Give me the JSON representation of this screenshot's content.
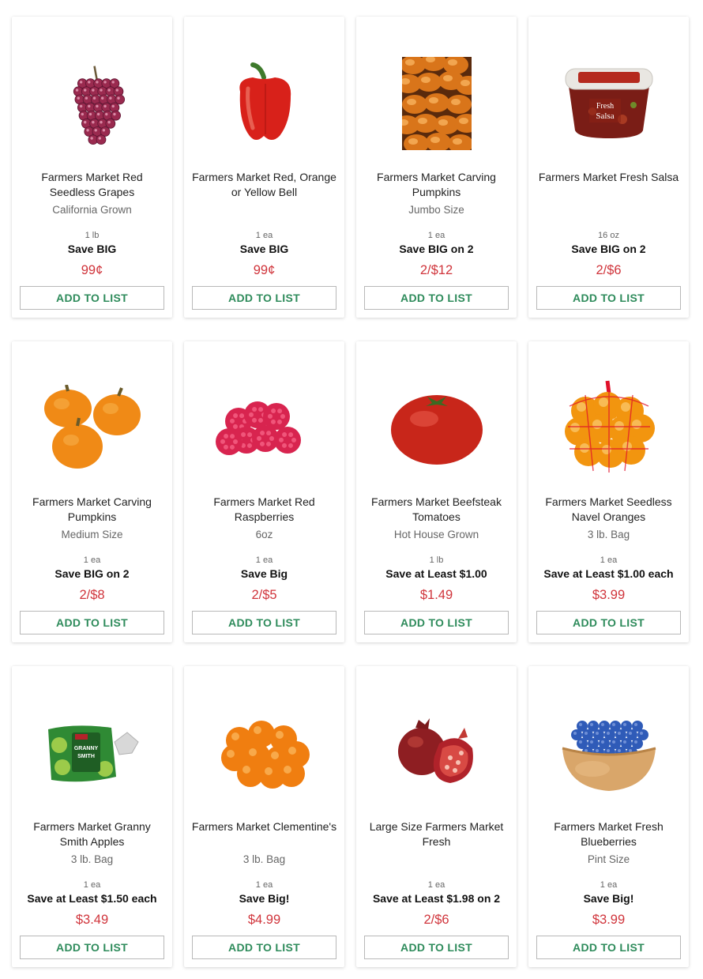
{
  "products": [
    {
      "name": "Farmers Market Red Seedless Grapes",
      "size": "California Grown",
      "unit": "1 lb",
      "deal": "Save BIG",
      "price": "99¢",
      "button": "ADD TO LIST",
      "image": "grapes"
    },
    {
      "name": "Farmers Market Red, Orange or Yellow Bell",
      "size": "",
      "unit": "1 ea",
      "deal": "Save BIG",
      "price": "99¢",
      "button": "ADD TO LIST",
      "image": "bell-pepper"
    },
    {
      "name": "Farmers Market Carving Pumpkins",
      "size": "Jumbo Size",
      "unit": "1 ea",
      "deal": "Save BIG on 2",
      "price": "2/$12",
      "button": "ADD TO LIST",
      "image": "pumpkin-pile"
    },
    {
      "name": "Farmers Market Fresh Salsa",
      "size": "",
      "unit": "16 oz",
      "deal": "Save BIG on 2",
      "price": "2/$6",
      "button": "ADD TO LIST",
      "image": "salsa-tub"
    },
    {
      "name": "Farmers Market Carving Pumpkins",
      "size": "Medium Size",
      "unit": "1 ea",
      "deal": "Save BIG on 2",
      "price": "2/$8",
      "button": "ADD TO LIST",
      "image": "pumpkins"
    },
    {
      "name": "Farmers Market Red Raspberries",
      "size": "6oz",
      "unit": "1 ea",
      "deal": "Save Big",
      "price": "2/$5",
      "button": "ADD TO LIST",
      "image": "raspberries"
    },
    {
      "name": "Farmers Market Beefsteak Tomatoes",
      "size": "Hot House Grown",
      "unit": "1 lb",
      "deal": "Save at Least $1.00",
      "price": "$1.49",
      "button": "ADD TO LIST",
      "image": "tomato"
    },
    {
      "name": "Farmers Market Seedless Navel Oranges",
      "size": "3 lb. Bag",
      "unit": "1 ea",
      "deal": "Save at Least $1.00 each",
      "price": "$3.99",
      "button": "ADD TO LIST",
      "image": "orange-bag"
    },
    {
      "name": "Farmers Market Granny Smith Apples",
      "size": "3 lb. Bag",
      "unit": "1 ea",
      "deal": "Save at Least $1.50 each",
      "price": "$3.49",
      "button": "ADD TO LIST",
      "image": "apple-bag"
    },
    {
      "name": "Farmers Market Clementine's",
      "size": "3 lb. Bag",
      "unit": "1 ea",
      "deal": "Save Big!",
      "price": "$4.99",
      "button": "ADD TO LIST",
      "image": "clementines"
    },
    {
      "name": "Large Size Farmers Market Fresh",
      "size": "",
      "unit": "1 ea",
      "deal": "Save at Least $1.98 on 2",
      "price": "2/$6",
      "button": "ADD TO LIST",
      "image": "pomegranate"
    },
    {
      "name": "Farmers Market Fresh Blueberries",
      "size": "Pint Size",
      "unit": "1 ea",
      "deal": "Save Big!",
      "price": "$3.99",
      "button": "ADD TO LIST",
      "image": "blueberries"
    }
  ],
  "salsa_label": {
    "brand": "Fresh",
    "word": "Salsa"
  },
  "apple_label": {
    "line1": "GRANNY",
    "line2": "SMITH"
  },
  "colors": {
    "price": "#d0343b",
    "button_text": "#2e8b5b",
    "button_border": "#b8b8b8"
  }
}
